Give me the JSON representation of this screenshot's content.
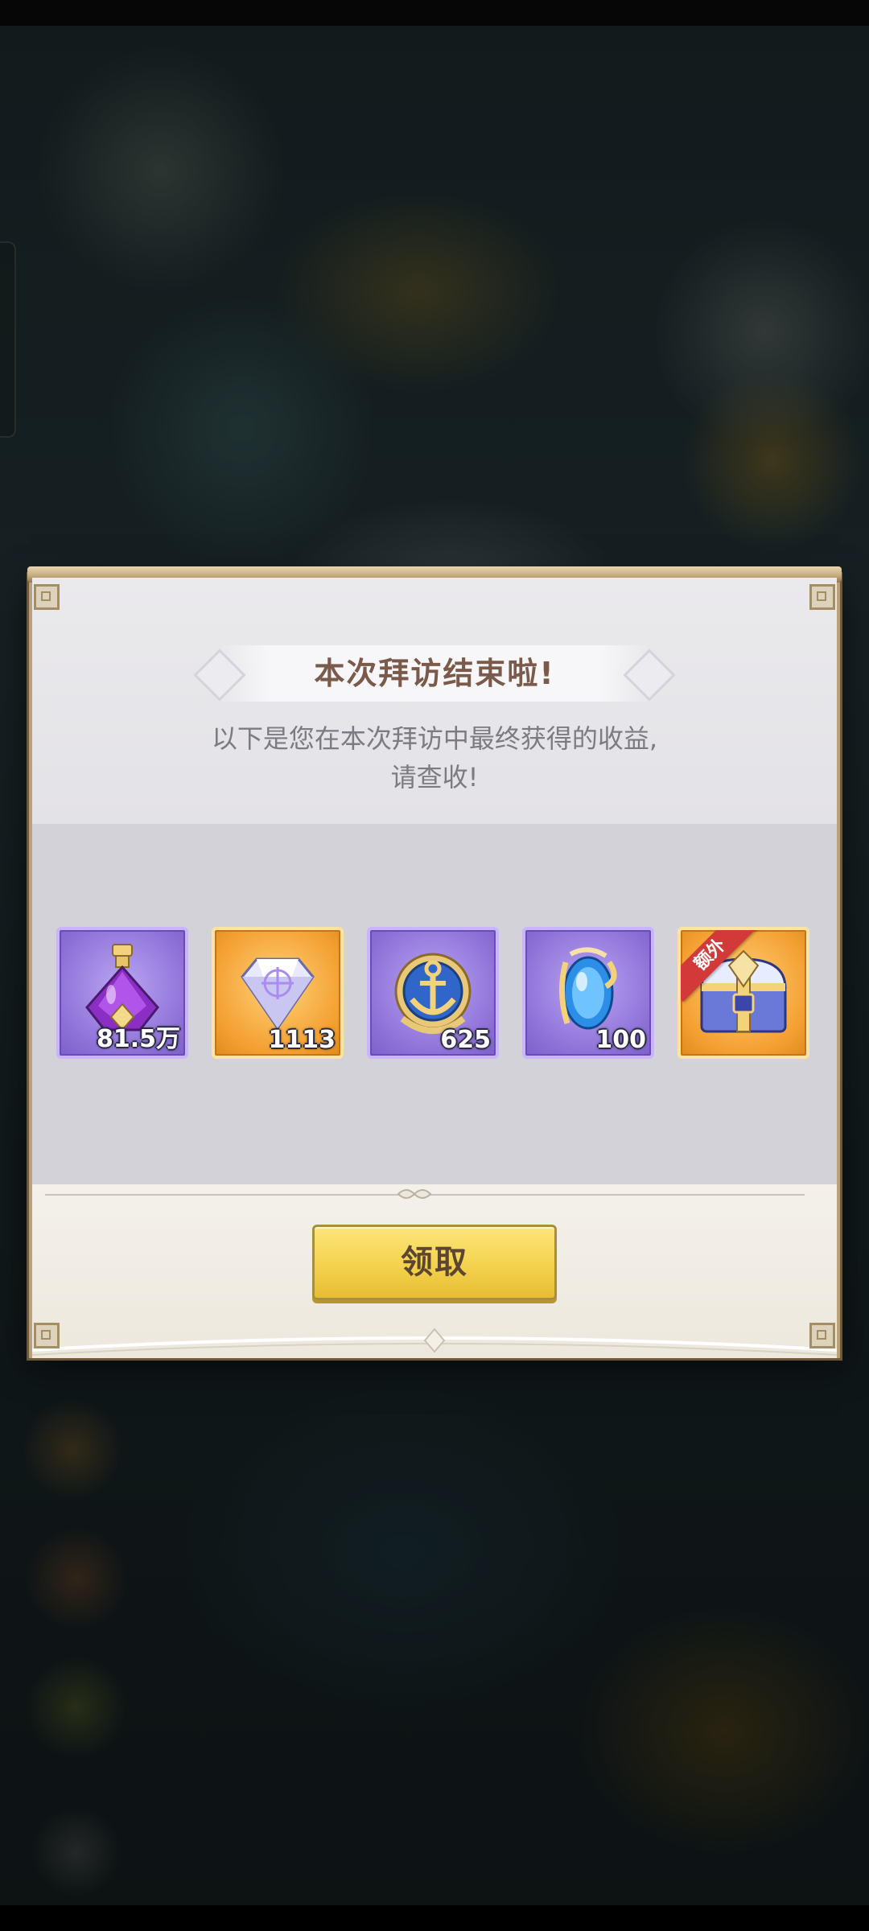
{
  "dialog": {
    "title": "本次拜访结束啦!",
    "subtitle_line1": "以下是您在本次拜访中最终获得的收益,",
    "subtitle_line2": "请查收!",
    "claim_label": "领取"
  },
  "rewards": [
    {
      "icon": "potion-bottle-icon",
      "count": "81.5万",
      "rarity": "purple"
    },
    {
      "icon": "diamond-gem-icon",
      "count": "1113",
      "rarity": "orange"
    },
    {
      "icon": "anchor-emblem-icon",
      "count": "625",
      "rarity": "purple"
    },
    {
      "icon": "blue-crystal-icon",
      "count": "100",
      "rarity": "purple"
    },
    {
      "icon": "treasure-chest-icon",
      "count": "",
      "rarity": "orange",
      "ribbon": "额外"
    }
  ],
  "colors": {
    "title": "#7a5a4a",
    "button": "#f4d24e",
    "purple_frame": "#8f72d8",
    "orange_frame": "#f4a032",
    "ribbon": "#d23a3a"
  }
}
